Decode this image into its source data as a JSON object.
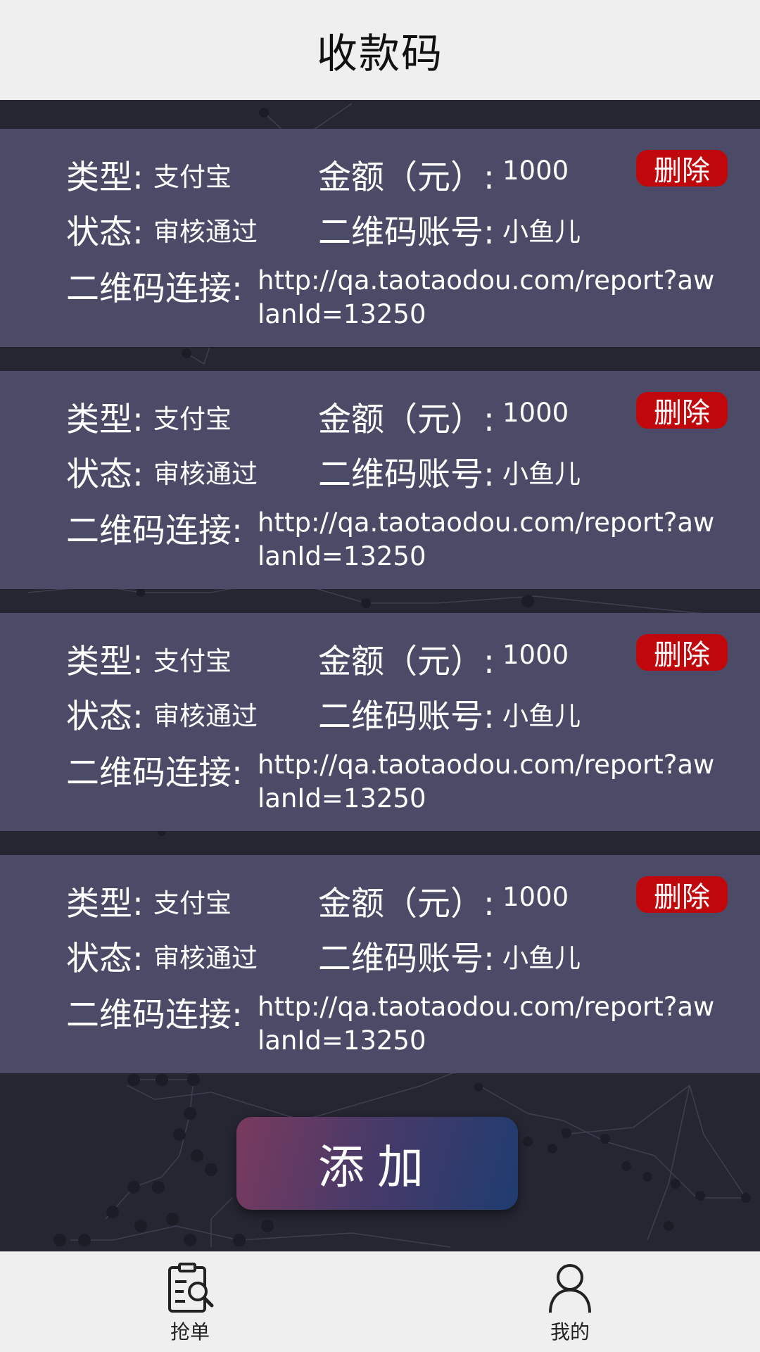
{
  "header": {
    "title": "收款码"
  },
  "labels": {
    "type": "类型:",
    "amount": "金额（元）:",
    "status": "状态:",
    "account": "二维码账号:",
    "link": "二维码连接:",
    "delete": "删除"
  },
  "cards": [
    {
      "type": "支付宝",
      "amount": "1000",
      "status": "审核通过",
      "account": "小鱼儿",
      "link": "http://qa.taotaodou.com/report?awlanId=13250"
    },
    {
      "type": "支付宝",
      "amount": "1000",
      "status": "审核通过",
      "account": "小鱼儿",
      "link": "http://qa.taotaodou.com/report?awlanId=13250"
    },
    {
      "type": "支付宝",
      "amount": "1000",
      "status": "审核通过",
      "account": "小鱼儿",
      "link": "http://qa.taotaodou.com/report?awlanId=13250"
    },
    {
      "type": "支付宝",
      "amount": "1000",
      "status": "审核通过",
      "account": "小鱼儿",
      "link": "http://qa.taotaodou.com/report?awlanId=13250"
    }
  ],
  "add_button": {
    "label": "添加"
  },
  "tabs": [
    {
      "label": "抢单",
      "icon": "order-search-icon"
    },
    {
      "label": "我的",
      "icon": "user-icon"
    }
  ],
  "colors": {
    "card_bg": "#4b4b68",
    "page_bg": "#262633",
    "delete_red": "#c0080c",
    "bar_bg": "#efefef"
  }
}
